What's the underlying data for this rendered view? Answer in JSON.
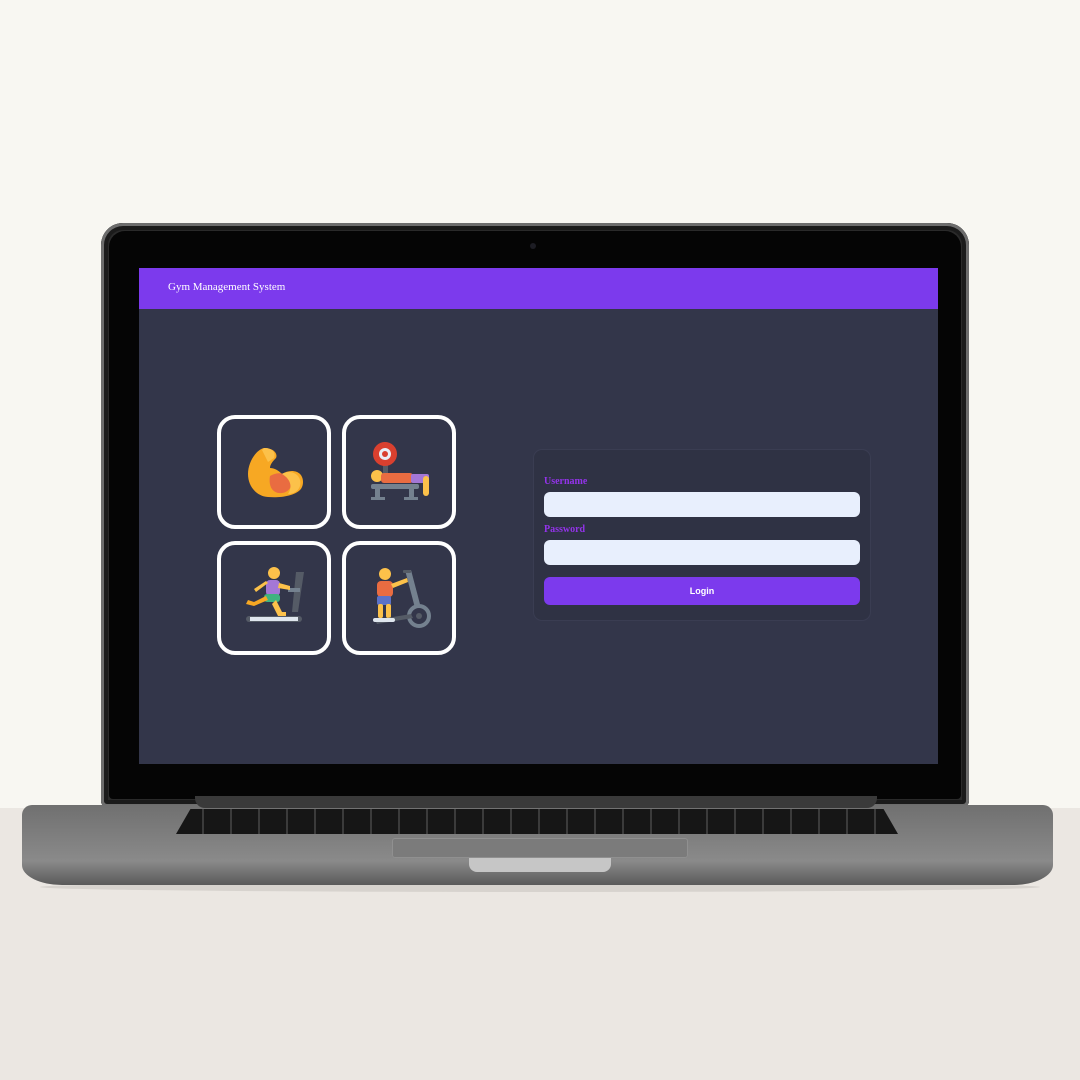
{
  "app": {
    "title": "Gym Management System"
  },
  "tiles": [
    {
      "icon": "flexed-biceps-icon"
    },
    {
      "icon": "bench-press-icon"
    },
    {
      "icon": "treadmill-runner-icon"
    },
    {
      "icon": "elliptical-trainer-icon"
    }
  ],
  "login": {
    "username_label": "Username",
    "username_value": "",
    "password_label": "Password",
    "password_value": "",
    "submit_label": "Login"
  },
  "colors": {
    "accent": "#7c3aed",
    "label": "#9333ea",
    "screen_background": "#33364a",
    "input_background": "#e8effd"
  }
}
